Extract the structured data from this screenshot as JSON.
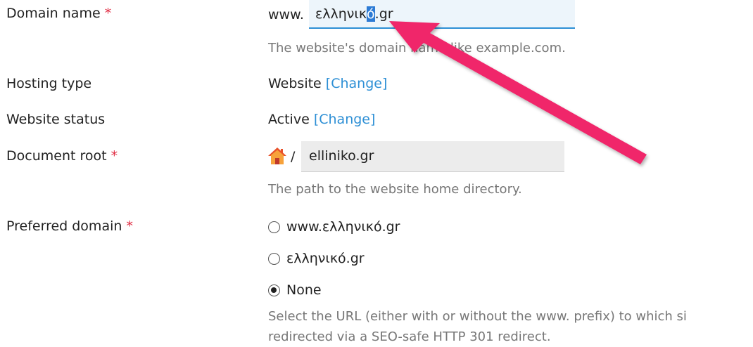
{
  "form": {
    "domain_name": {
      "label": "Domain name",
      "required_mark": "*",
      "prefix": "www.",
      "value_before_selection": "ελληνικ",
      "value_selected": "ό",
      "value_after_selection": ".gr",
      "hint": "The website's domain name like example.com."
    },
    "hosting_type": {
      "label": "Hosting type",
      "value": "Website",
      "change_link": "[Change]"
    },
    "website_status": {
      "label": "Website status",
      "value": "Active",
      "change_link": "[Change]"
    },
    "document_root": {
      "label": "Document root",
      "required_mark": "*",
      "icon": "home-icon",
      "separator": "/",
      "value": "elliniko.gr",
      "hint": "The path to the website home directory."
    },
    "preferred_domain": {
      "label": "Preferred domain",
      "required_mark": "*",
      "options": [
        {
          "label": "www.ελληνικό.gr",
          "checked": false
        },
        {
          "label": "ελληνικό.gr",
          "checked": false
        },
        {
          "label": "None",
          "checked": true
        }
      ],
      "hint_line1": "Select the URL (either with or without the www. prefix) to which si",
      "hint_line2": "redirected via a SEO-safe HTTP 301 redirect."
    }
  },
  "colors": {
    "required": "#e0283f",
    "link": "#2d8fd5",
    "hint": "#777777",
    "annotation_arrow": "#f0266b",
    "selection": "#2d7bd5"
  }
}
